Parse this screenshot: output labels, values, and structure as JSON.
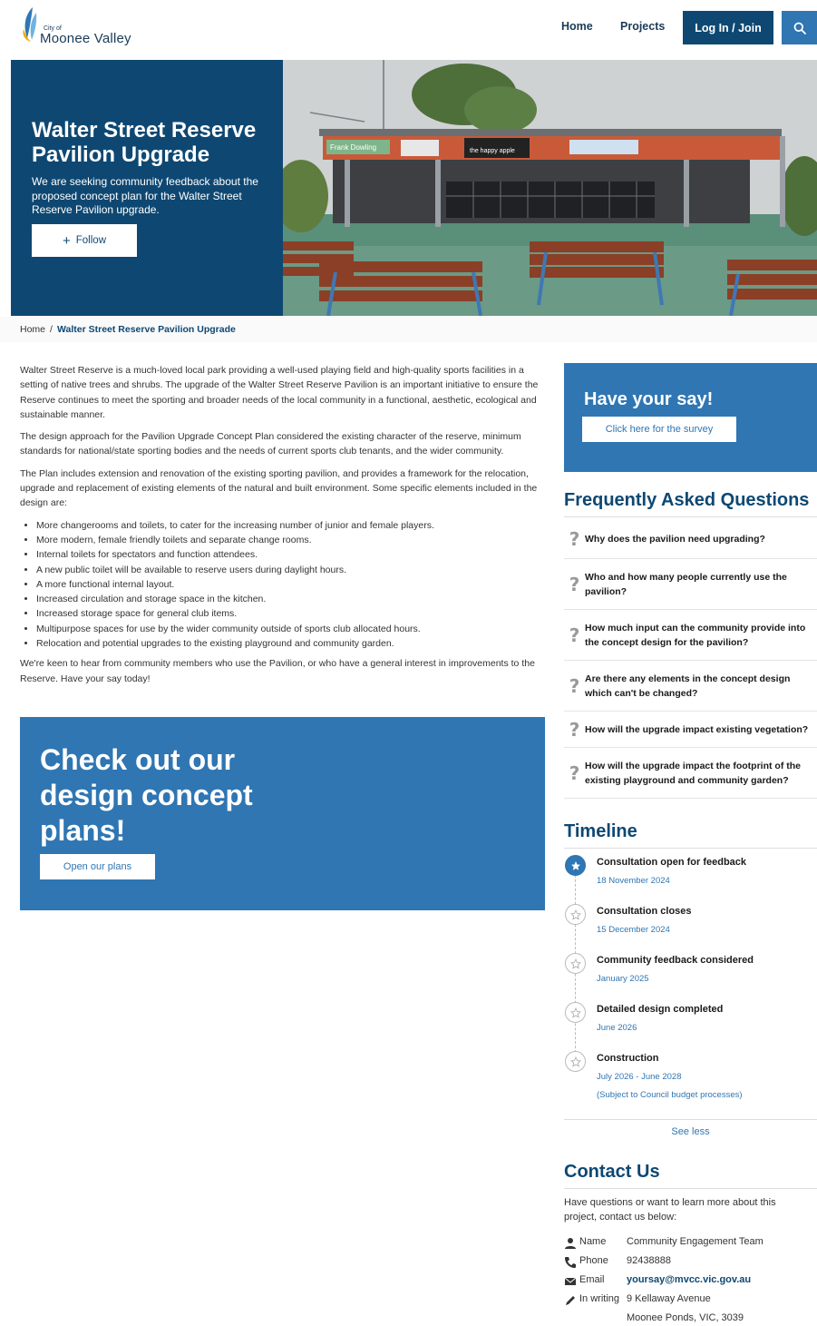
{
  "header": {
    "logo_city_of": "City of",
    "logo_name": "Moonee Valley",
    "nav_home": "Home",
    "nav_projects": "Projects",
    "nav_login": "Log In / Join",
    "search_icon": "search-icon"
  },
  "hero": {
    "title": "Walter Street Reserve Pavilion Upgrade",
    "description": "We are seeking community feedback about the proposed concept plan for the Walter Street Reserve Pavilion upgrade.",
    "follow_label": "Follow",
    "sign_names": [
      "Frank Dowling",
      "the happy apple"
    ]
  },
  "breadcrumb": {
    "home": "Home",
    "separator": "/",
    "current": "Walter Street Reserve Pavilion Upgrade"
  },
  "main": {
    "paragraph1": "Walter Street Reserve is a much-loved local park providing a well-used playing field and high-quality sports facilities in a setting of native trees and shrubs. The upgrade of the Walter Street Reserve Pavilion is an important initiative to ensure the Reserve continues to meet the sporting and broader needs of the local community in a functional, aesthetic, ecological and sustainable manner.",
    "paragraph2": "The design approach for the Pavilion Upgrade Concept Plan considered the existing character of the reserve, minimum standards for national/state sporting bodies and the needs of current sports club tenants, and the wider community.",
    "paragraph3": "The Plan includes extension and renovation of the existing sporting pavilion, and provides a framework for the relocation, upgrade and replacement of existing elements of the natural and built environment. Some specific elements included in the design are:",
    "bullets": [
      "More changerooms and toilets, to cater for the increasing number of junior and female players.",
      "More modern, female friendly toilets and separate change rooms.",
      "Internal toilets for spectators and function attendees.",
      "A new public toilet will be available to reserve users during daylight hours.",
      "A more functional internal layout.",
      "Increased circulation and storage space in the kitchen.",
      "Increased storage space for general club items.",
      "Multipurpose spaces for use by the wider community outside of sports club allocated hours.",
      "Relocation and potential upgrades to the existing playground and community garden."
    ],
    "paragraph4": "We're keen to hear from community members who use the Pavilion, or who have a general interest in improvements to the Reserve. Have your say today!",
    "concept_title": "Check out our design concept plans!",
    "concept_button": "Open our plans"
  },
  "sidebar": {
    "say_title": "Have your say!",
    "say_button": "Click here for the survey",
    "faq_title": "Frequently Asked Questions",
    "faq_items": [
      "Why does the pavilion need upgrading?",
      "Who and how many people currently use the pavilion?",
      "How much input can the community provide into the concept design for the pavilion?",
      "Are there any elements in the concept design which can't be changed?",
      "How will the upgrade impact existing vegetation?",
      "How will the upgrade impact the footprint of the existing playground and community garden?"
    ],
    "timeline_title": "Timeline",
    "timeline": [
      {
        "name": "Consultation open for feedback",
        "date": "18 November 2024",
        "note": ""
      },
      {
        "name": "Consultation closes",
        "date": "15 December 2024",
        "note": ""
      },
      {
        "name": "Community feedback considered",
        "date": "January 2025",
        "note": ""
      },
      {
        "name": "Detailed design completed",
        "date": "June 2026",
        "note": ""
      },
      {
        "name": "Construction",
        "date": "July 2026 - June 2028",
        "note": "(Subject to Council budget processes)"
      }
    ],
    "see_less": "See less",
    "contact_title": "Contact Us",
    "contact_intro": "Have questions or want to learn more about this project, contact us below:",
    "contact": {
      "name_label": "Name",
      "name_value": "Community Engagement Team",
      "phone_label": "Phone",
      "phone_value": "92438888",
      "email_label": "Email",
      "email_value": "yoursay@mvcc.vic.gov.au",
      "writing_label": "In writing",
      "writing_line1": "9 Kellaway Avenue",
      "writing_line2": "Moonee Ponds, VIC, 3039"
    }
  },
  "colors": {
    "navy": "#0e4872",
    "blue": "#2f76b3"
  }
}
